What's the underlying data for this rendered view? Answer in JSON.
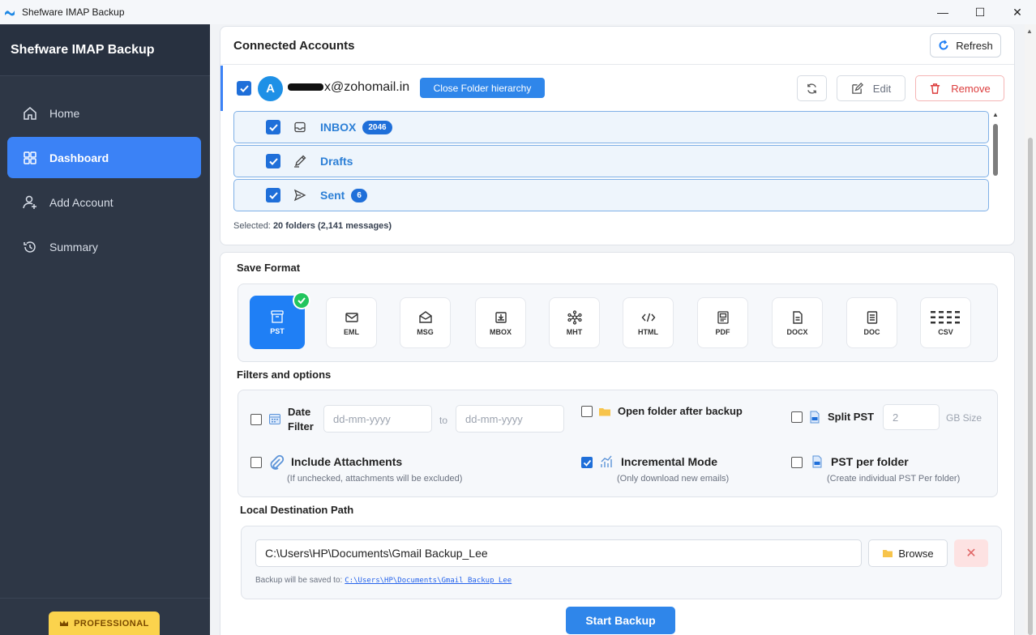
{
  "window": {
    "title": "Shefware IMAP Backup",
    "minimize": "—",
    "maximize": "☐",
    "close": "✕"
  },
  "sidebar": {
    "brand": "Shefware IMAP Backup",
    "items": [
      {
        "label": "Home",
        "icon": "home-icon",
        "active": false
      },
      {
        "label": "Dashboard",
        "icon": "dashboard-icon",
        "active": true
      },
      {
        "label": "Add Account",
        "icon": "add-user-icon",
        "active": false
      },
      {
        "label": "Summary",
        "icon": "history-icon",
        "active": false
      }
    ],
    "badge": "PROFESSIONAL"
  },
  "accounts": {
    "title": "Connected Accounts",
    "refresh_label": "Refresh",
    "account": {
      "avatar_letter": "A",
      "email_suffix": "x@zohomail.in",
      "close_hierarchy_label": "Close Folder hierarchy",
      "edit_label": "Edit",
      "remove_label": "Remove"
    },
    "folders": [
      {
        "name": "INBOX",
        "count": "2046",
        "icon": "inbox-icon"
      },
      {
        "name": "Drafts",
        "count": "",
        "icon": "pencil-icon"
      },
      {
        "name": "Sent",
        "count": "6",
        "icon": "send-icon"
      }
    ],
    "selected_prefix": "Selected:",
    "selected_value": "20 folders (2,141 messages)"
  },
  "save_format": {
    "title": "Save Format",
    "formats": [
      {
        "label": "PST",
        "icon": "archive-icon",
        "selected": true
      },
      {
        "label": "EML",
        "icon": "envelope-icon",
        "selected": false
      },
      {
        "label": "MSG",
        "icon": "open-envelope-icon",
        "selected": false
      },
      {
        "label": "MBOX",
        "icon": "tray-download-icon",
        "selected": false
      },
      {
        "label": "MHT",
        "icon": "network-icon",
        "selected": false
      },
      {
        "label": "HTML",
        "icon": "code-icon",
        "selected": false
      },
      {
        "label": "PDF",
        "icon": "pdf-icon",
        "selected": false
      },
      {
        "label": "DOCX",
        "icon": "docx-icon",
        "selected": false
      },
      {
        "label": "DOC",
        "icon": "doc-icon",
        "selected": false
      },
      {
        "label": "CSV",
        "icon": "csv-icon",
        "selected": false
      }
    ]
  },
  "filters": {
    "title": "Filters and options",
    "date_filter_line1": "Date",
    "date_filter_line2": "Filter",
    "date_from_placeholder": "dd-mm-yyyy",
    "date_to_label": "to",
    "date_to_placeholder": "dd-mm-yyyy",
    "open_folder_label": "Open folder after backup",
    "split_pst_label": "Split PST",
    "split_pst_value": "2",
    "gb_size_label": "GB Size",
    "include_attachments_label": "Include Attachments",
    "include_attachments_note": "(If unchecked, attachments will be excluded)",
    "incremental_label": "Incremental Mode",
    "incremental_note": "(Only download new emails)",
    "incremental_checked": true,
    "pst_per_folder_label": "PST per folder",
    "pst_per_folder_note": "(Create individual PST Per folder)"
  },
  "destination": {
    "title": "Local Destination Path",
    "path": "C:\\Users\\HP\\Documents\\Gmail Backup_Lee",
    "browse_label": "Browse",
    "clear_label": "✕",
    "note_prefix": "Backup will be saved to:",
    "note_path": "C:\\Users\\HP\\Documents\\Gmail_Backup_Lee"
  },
  "start_label": "Start Backup",
  "colors": {
    "sidebar_bg": "#2e3746",
    "accent": "#3b82f6",
    "remove": "#dc3c3c",
    "badge": "#fbd34d",
    "success": "#22c55e"
  }
}
